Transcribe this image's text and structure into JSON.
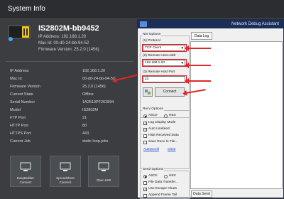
{
  "header": {
    "title": "System Info"
  },
  "device": {
    "name": "IS2802M-bb9452",
    "ip_line": "IP Address: 192.168.1.20",
    "mac_line": "Mac Id: 00-d0-24-bb-94-52",
    "fw_line": "Firmware Version: 25.2.0 (1456)"
  },
  "info_rows": [
    {
      "k": "IP Address",
      "v": "192.168.1.20"
    },
    {
      "k": "Mac Id",
      "v": "00-d0-24-bb-94-52"
    },
    {
      "k": "Firmware Version",
      "v": "25.2.0 (1456)"
    },
    {
      "k": "Current State",
      "v": "Offline"
    },
    {
      "k": "Serial Number",
      "v": "1A2519PF262894"
    },
    {
      "k": "Model",
      "v": "IS2802M"
    },
    {
      "k": "FTP Port",
      "v": "21"
    },
    {
      "k": "HTTP Port",
      "v": "80"
    },
    {
      "k": "HTTPS Port",
      "v": "443"
    },
    {
      "k": "Current Job",
      "v": "static loop.jobx"
    }
  ],
  "tiles": [
    {
      "label1": "EasyBuilder",
      "label2": "Connect"
    },
    {
      "label1": "Spreadsheet",
      "label2": "Connect"
    },
    {
      "label1": "Open HMI",
      "label2": ""
    }
  ],
  "assistant": {
    "title": "Network Debug Assistant",
    "net_options": "Net Options",
    "protocol_label": "(1) Protocol",
    "protocol_value": "TCP Client",
    "host_addr_label": "(2) Remote Host Addr",
    "host_addr_value": "192.168.1.20",
    "host_port_label": "(3) Remote Host Port",
    "host_port_value": "23",
    "connect_label": "Connect",
    "recv_options": "Recv Options",
    "recv_ascii": "ASCII",
    "recv_hex": "HEX",
    "log_display_mode": "Log Display Mode",
    "auto_linefeed": "Auto Linefeed",
    "hide_received": "Hide Received Data",
    "save_recv": "Save Recv to File...",
    "auto_scroll": "AutoScroll",
    "clear": "Clear",
    "send_options": "Send Options",
    "send_ascii": "ASCII",
    "send_hex": "HEX",
    "file_transfer": "File Data Transfer...",
    "use_escape": "Use Escape Chars",
    "append_frame": "Append Frame Tail",
    "data_log_tab": "Data Log",
    "data_send_tab": "Data Send"
  },
  "colors": {
    "accent_red": "#e0262e",
    "title_blue": "#1a2e58"
  }
}
